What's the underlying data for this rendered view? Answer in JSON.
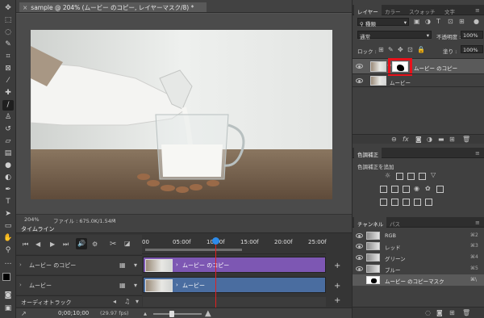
{
  "document": {
    "tab_title": "sample @ 204% (ムービー のコピー, レイヤーマスク/8) *",
    "close_symbol": "×",
    "zoom": "204%",
    "file_info": "ファイル : 675.0K/1.54M"
  },
  "timeline": {
    "title": "タイムライン",
    "ruler": [
      "00",
      "05:00f",
      "10:00f",
      "15:00f",
      "20:00f",
      "25:00f"
    ],
    "tracks": [
      {
        "name": "ムービー のコピー",
        "clip_label": "ムービー のコピー",
        "color": "#7d57b3"
      },
      {
        "name": "ムービー",
        "clip_label": "ムービー",
        "color": "#4a6da0"
      }
    ],
    "audio_track": "オーディオトラック",
    "current_time": "0;00;10;00",
    "fps": "(29.97 fps)",
    "add_symbol": "+",
    "playhead_fraction": 0.4
  },
  "layers_panel": {
    "tabs": [
      "レイヤー",
      "カラー",
      "スウォッチ",
      "文字"
    ],
    "filter_label": "種類",
    "blend_mode": "通常",
    "opacity_label": "不透明度 :",
    "opacity_value": "100%",
    "lock_label": "ロック :",
    "fill_label": "塗り :",
    "fill_value": "100%",
    "layers": [
      {
        "name": "ムービー のコピー",
        "selected": true
      },
      {
        "name": "ムービー",
        "selected": false
      }
    ],
    "mask_highlight_color": "#e8121b"
  },
  "adjustments_panel": {
    "title": "色調補正",
    "subtitle": "色調補正を追加"
  },
  "channels_panel": {
    "tabs": [
      "チャンネル",
      "パス"
    ],
    "channels": [
      {
        "name": "RGB",
        "shortcut": "⌘2"
      },
      {
        "name": "レッド",
        "shortcut": "⌘3"
      },
      {
        "name": "グリーン",
        "shortcut": "⌘4"
      },
      {
        "name": "ブルー",
        "shortcut": "⌘5"
      },
      {
        "name": "ムービー のコピーマスク",
        "shortcut": "⌘\\"
      }
    ]
  },
  "accent_color": "#2d8ceb"
}
